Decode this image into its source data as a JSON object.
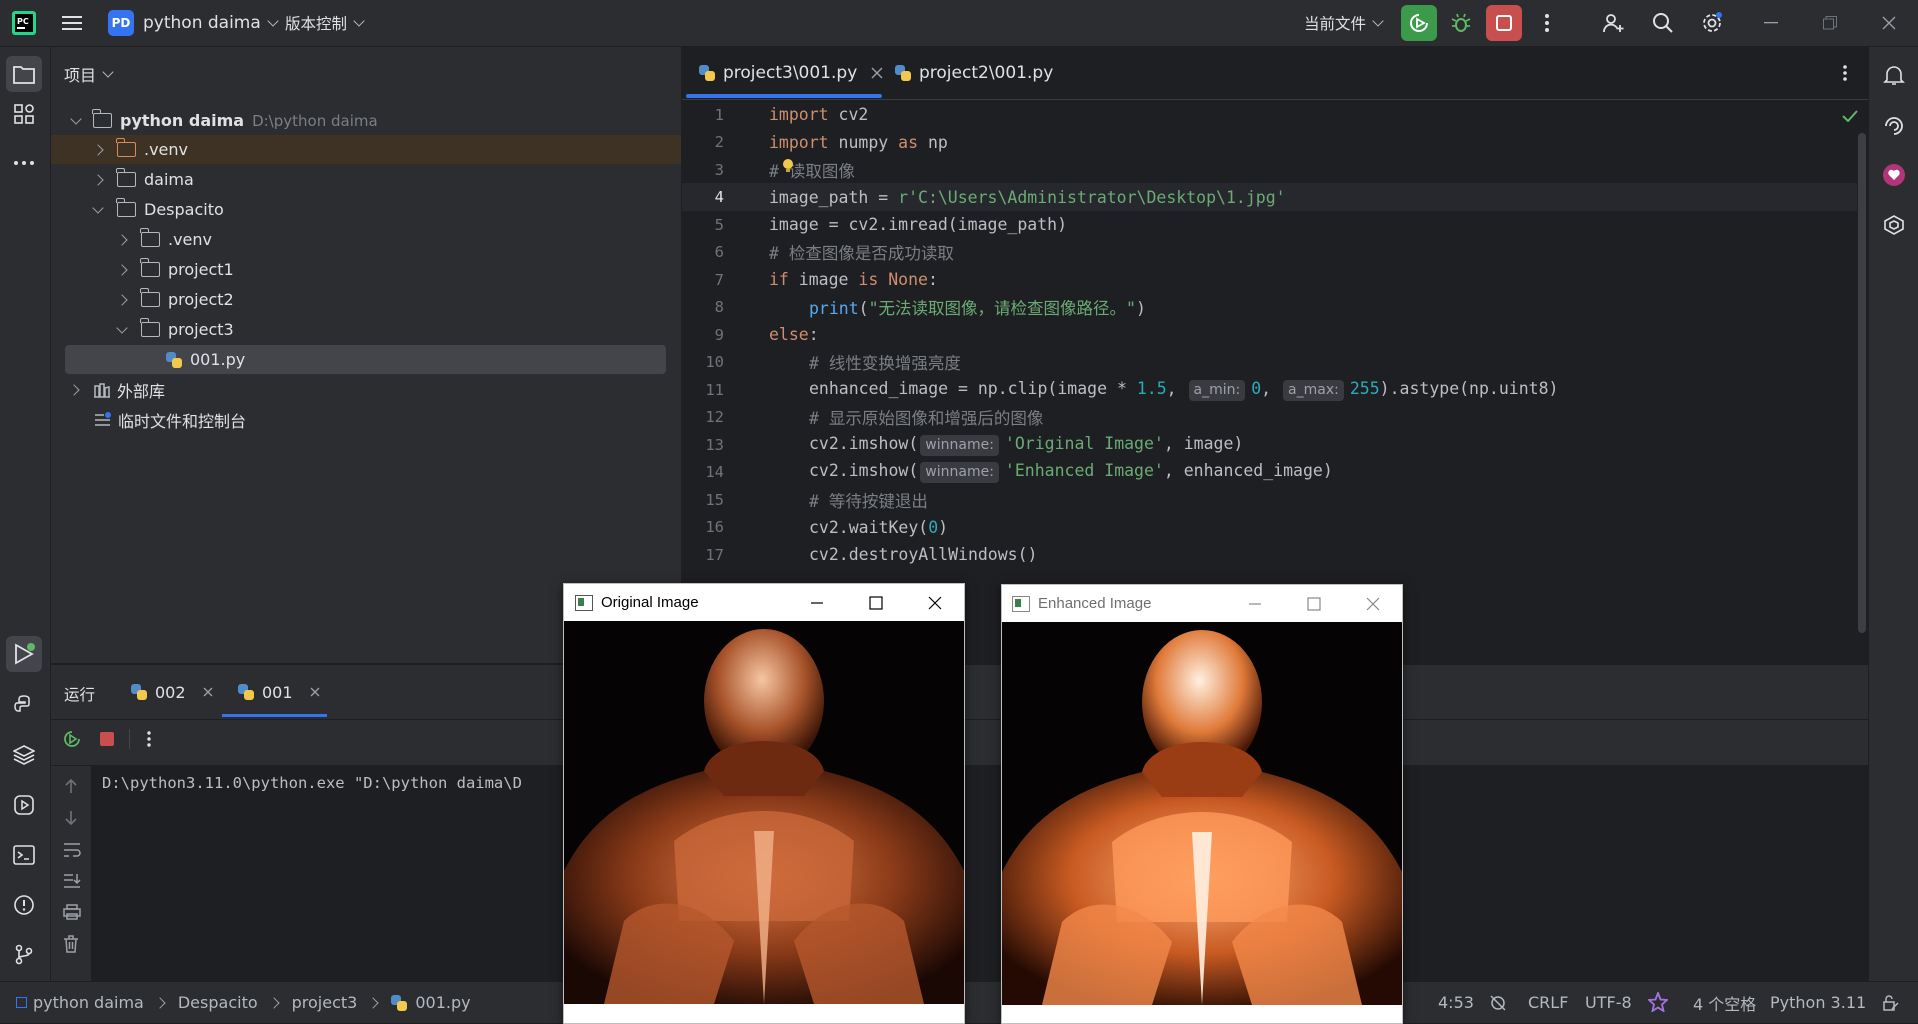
{
  "titlebar": {
    "project_badge": "PD",
    "project_name": "python daima",
    "vcs_label": "版本控制",
    "run_config": "当前文件"
  },
  "project_panel": {
    "header": "项目",
    "root_name": "python daima",
    "root_path": "D:\\python daima",
    "items": [
      {
        "label": ".venv"
      },
      {
        "label": "daima"
      },
      {
        "label": "Despacito"
      },
      {
        "label": ".venv"
      },
      {
        "label": "project1"
      },
      {
        "label": "project2"
      },
      {
        "label": "project3"
      },
      {
        "label": "001.py"
      },
      {
        "label": "外部库"
      },
      {
        "label": "临时文件和控制台"
      }
    ]
  },
  "editor": {
    "tabs": [
      {
        "label": "project3\\001.py",
        "active": true
      },
      {
        "label": "project2\\001.py",
        "active": false
      }
    ],
    "lines": [
      {
        "n": "1"
      },
      {
        "n": "2"
      },
      {
        "n": "3"
      },
      {
        "n": "4"
      },
      {
        "n": "5"
      },
      {
        "n": "6"
      },
      {
        "n": "7"
      },
      {
        "n": "8"
      },
      {
        "n": "9"
      },
      {
        "n": "10"
      },
      {
        "n": "11"
      },
      {
        "n": "12"
      },
      {
        "n": "13"
      },
      {
        "n": "14"
      },
      {
        "n": "15"
      },
      {
        "n": "16"
      },
      {
        "n": "17"
      }
    ],
    "code": {
      "l1_kw": "import",
      "l1_mod": " cv2",
      "l2_kw": "import",
      "l2_mod": " numpy ",
      "l2_as": "as",
      "l2_alias": " np",
      "l3": "# 读取图像",
      "l4_var": "image_path = ",
      "l4_str": "r'C:\\Users\\Administrator\\Desktop\\1.jpg'",
      "l5": "image = cv2.imread(image_path)",
      "l6": "# 检查图像是否成功读取",
      "l7_if": "if",
      "l7_mid": " image ",
      "l7_is": "is",
      "l7_none": " None",
      "l7_colon": ":",
      "l8_fn": "print",
      "l8_open": "(",
      "l8_str": "\"无法读取图像，请检查图像路径。\"",
      "l8_close": ")",
      "l9_else": "else",
      "l9_colon": ":",
      "l10": "# 线性变换增强亮度",
      "l11_a": "enhanced_image = np.clip(image * ",
      "l11_n1": "1.5",
      "l11_c1": ", ",
      "l11_h1": "a_min:",
      "l11_n2": "0",
      "l11_c2": ", ",
      "l11_h2": "a_max:",
      "l11_n3": "255",
      "l11_b": ").astype(np.uint8)",
      "l12": "# 显示原始图像和增强后的图像",
      "l13_a": "cv2.imshow(",
      "l13_h": "winname:",
      "l13_str": "'Original Image'",
      "l13_b": ", image)",
      "l14_a": "cv2.imshow(",
      "l14_h": "winname:",
      "l14_str": "'Enhanced Image'",
      "l14_b": ", enhanced_image)",
      "l15": "# 等待按键退出",
      "l16_a": "cv2.waitKey(",
      "l16_n": "0",
      "l16_b": ")",
      "l17": "cv2.destroyAllWindows()"
    }
  },
  "run_panel": {
    "title": "运行",
    "tabs": [
      {
        "label": "002"
      },
      {
        "label": "001"
      }
    ],
    "console_line": "D:\\python3.11.0\\python.exe \"D:\\python daima\\D"
  },
  "cv_windows": [
    {
      "title": "Original Image"
    },
    {
      "title": "Enhanced Image"
    }
  ],
  "statusbar": {
    "breadcrumb": [
      "python daima",
      "Despacito",
      "project3",
      "001.py"
    ],
    "position": "4:53",
    "line_sep": "CRLF",
    "encoding": "UTF-8",
    "indent": "4 个空格",
    "interpreter": "Python 3.11"
  },
  "colors": {
    "run_button": "#3c9a4b",
    "stop_button": "#c94f4f",
    "project_badge": "#3574f0",
    "keyword": "#cf8e6d",
    "string": "#6aab73",
    "number": "#2aacb8"
  }
}
